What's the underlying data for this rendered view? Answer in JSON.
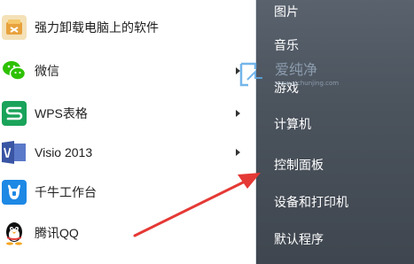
{
  "apps": [
    {
      "label": "强力卸载电脑上的软件",
      "icon": "uninstaller-icon",
      "has_submenu": false
    },
    {
      "label": "微信",
      "icon": "wechat-icon",
      "has_submenu": true
    },
    {
      "label": "WPS表格",
      "icon": "wps-spreadsheet-icon",
      "has_submenu": true
    },
    {
      "label": "Visio 2013",
      "icon": "visio-icon",
      "has_submenu": true
    },
    {
      "label": "千牛工作台",
      "icon": "qianniu-icon",
      "has_submenu": false
    },
    {
      "label": "腾讯QQ",
      "icon": "qq-penguin-icon",
      "has_submenu": false
    }
  ],
  "right_menu": {
    "items": [
      "图片",
      "音乐",
      "游戏",
      "计算机",
      "控制面板",
      "设备和打印机",
      "默认程序"
    ]
  },
  "watermark": {
    "text": "爱纯净",
    "subtext": "www.aichunjing.com"
  },
  "colors": {
    "right_panel": "#4b535d",
    "annotation_arrow": "#e53935",
    "wechat_green": "#2dc100",
    "wps_green": "#1aa35a",
    "visio_blue": "#3955a3",
    "qianniu_blue": "#1e88e5"
  }
}
